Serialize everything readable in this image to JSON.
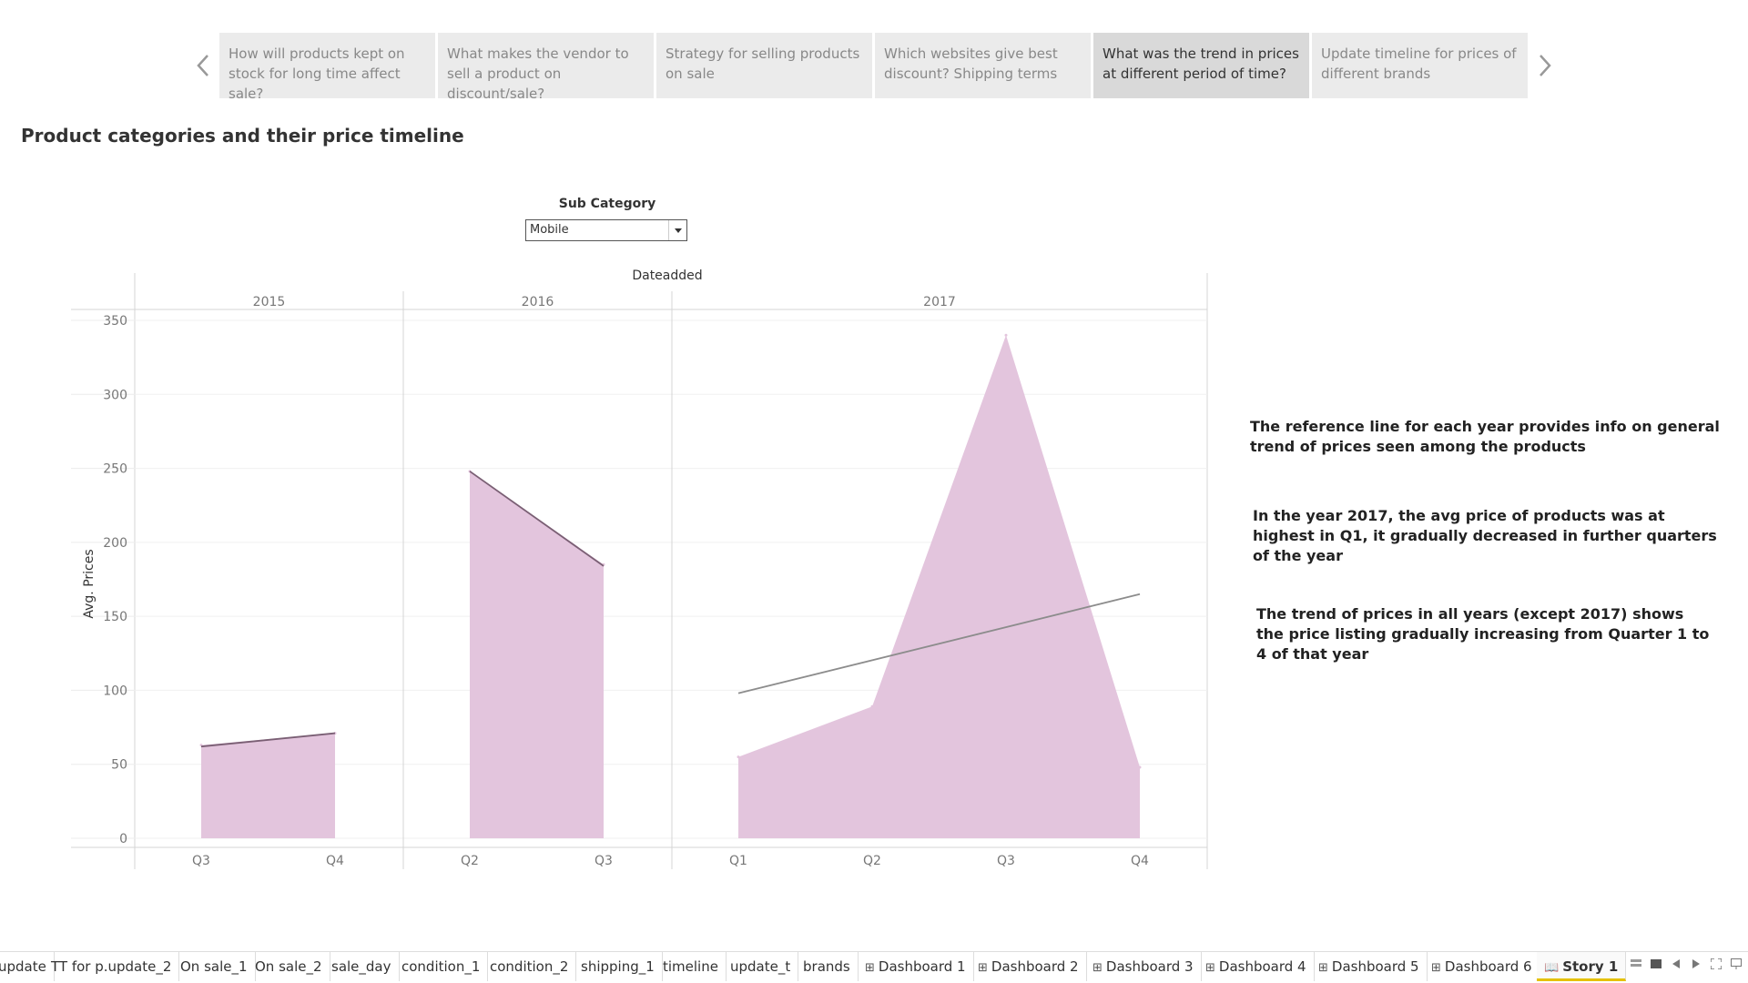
{
  "story": {
    "points": [
      "How will products kept on stock for long time affect sale?",
      "What makes the vendor to sell a product on discount/sale?",
      "Strategy for selling products on sale",
      "Which websites give best discount? Shipping terms",
      "What was the trend in prices at different period of time?",
      "Update timeline for prices of different brands"
    ],
    "active_index": 4
  },
  "title": "Product categories and their price timeline",
  "filter": {
    "label": "Sub Category",
    "value": "Mobile"
  },
  "chart_data": {
    "type": "area",
    "column_header": "Dateadded",
    "ylabel": "Avg. Prices",
    "ylim": [
      0,
      350
    ],
    "yticks": [
      0,
      50,
      100,
      150,
      200,
      250,
      300,
      350
    ],
    "fill_color": "#e3c5dd",
    "line_color": "#7a5f74",
    "trend_color": "#8c8c8c",
    "panels": [
      {
        "year": "2015",
        "quarters": [
          "Q3",
          "Q4"
        ],
        "values": [
          63,
          71
        ],
        "trend": [
          62,
          71
        ]
      },
      {
        "year": "2016",
        "quarters": [
          "Q2",
          "Q3"
        ],
        "values": [
          248,
          185
        ],
        "trend": [
          248,
          184
        ]
      },
      {
        "year": "2017",
        "quarters": [
          "Q1",
          "Q2",
          "Q3",
          "Q4"
        ],
        "values": [
          55,
          89,
          340,
          48
        ],
        "trend": [
          98,
          120,
          142,
          165
        ]
      }
    ]
  },
  "annotations": [
    "The reference line for each year provides info on general trend of prices seen among the products",
    "In the year 2017, the avg price of products was at highest in Q1, it gradually decreased in further quarters of the year",
    "The trend of prices in all years (except 2017) shows the price listing gradually increasing from Quarter 1 to 4 of that year"
  ],
  "tabs": [
    {
      "label": "update",
      "icon": ""
    },
    {
      "label": "TT for p.update_2",
      "icon": ""
    },
    {
      "label": "On sale_1",
      "icon": ""
    },
    {
      "label": "On sale_2",
      "icon": ""
    },
    {
      "label": "sale_day",
      "icon": ""
    },
    {
      "label": "condition_1",
      "icon": ""
    },
    {
      "label": "condition_2",
      "icon": ""
    },
    {
      "label": "shipping_1",
      "icon": ""
    },
    {
      "label": "timeline",
      "icon": ""
    },
    {
      "label": "update_t",
      "icon": ""
    },
    {
      "label": "brands",
      "icon": ""
    },
    {
      "label": "Dashboard 1",
      "icon": "⊞"
    },
    {
      "label": "Dashboard 2",
      "icon": "⊞"
    },
    {
      "label": "Dashboard 3",
      "icon": "⊞"
    },
    {
      "label": "Dashboard 4",
      "icon": "⊞"
    },
    {
      "label": "Dashboard 5",
      "icon": "⊞"
    },
    {
      "label": "Dashboard 6",
      "icon": "⊞"
    },
    {
      "label": "Story 1",
      "icon": "📖"
    }
  ],
  "active_tab": "Story 1"
}
